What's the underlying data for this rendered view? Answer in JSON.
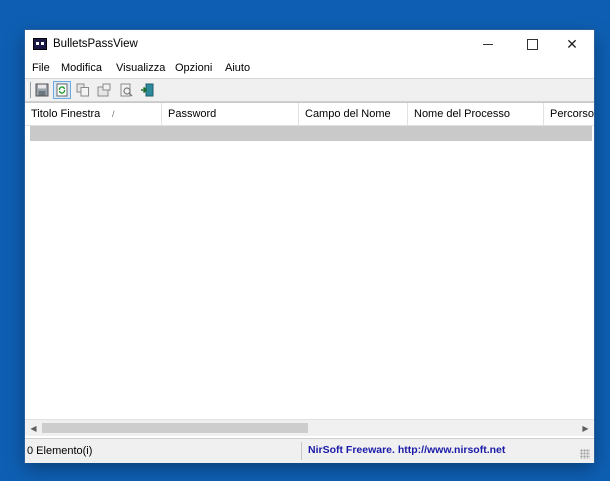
{
  "window": {
    "title": "BulletsPassView",
    "controls": {
      "minimize": "",
      "maximize": "",
      "close": "✕"
    }
  },
  "menu": [
    "File",
    "Modifica",
    "Visualizza",
    "Opzioni",
    "Aiuto"
  ],
  "toolbar": {
    "buttons": [
      {
        "icon": "save-icon",
        "active": false
      },
      {
        "icon": "refresh-icon",
        "active": true
      },
      {
        "icon": "copy-icon",
        "active": false
      },
      {
        "icon": "html-report-icon",
        "active": false
      },
      {
        "icon": "properties-icon",
        "active": false
      },
      {
        "icon": "exit-icon",
        "active": false
      }
    ]
  },
  "table": {
    "columns": [
      "Titolo Finestra",
      "Password",
      "Campo del Nome",
      "Nome del Processo",
      "Percorso"
    ],
    "sort_indicator": "/",
    "rows": []
  },
  "status": {
    "count": "0 Elemento(i)",
    "credit": "NirSoft Freeware.  http://www.nirsoft.net"
  }
}
